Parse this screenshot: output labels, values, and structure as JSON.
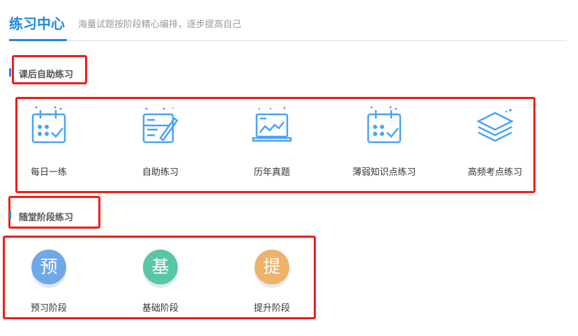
{
  "header": {
    "title": "练习中心",
    "subtitle": "海量试题按阶段精心编排，逐步提高自己"
  },
  "section1": {
    "title": "课后自助练习",
    "items": [
      {
        "label": "每日一练",
        "icon": "calendar-check-icon"
      },
      {
        "label": "自助练习",
        "icon": "notebook-pen-icon"
      },
      {
        "label": "历年真题",
        "icon": "laptop-chart-icon"
      },
      {
        "label": "薄弱知识点练习",
        "icon": "calendar-check-icon"
      },
      {
        "label": "高频考点练习",
        "icon": "layers-icon"
      }
    ]
  },
  "section2": {
    "title": "随堂阶段练习",
    "items": [
      {
        "label": "预习阶段",
        "glyph": "预",
        "color": "#6ea8e6"
      },
      {
        "label": "基础阶段",
        "glyph": "基",
        "color": "#57c7a8"
      },
      {
        "label": "提升阶段",
        "glyph": "提",
        "color": "#eeb26a"
      }
    ]
  },
  "colors": {
    "accent": "#1e88e5",
    "icon": "#4aa3f5",
    "annotation": "#f01d16"
  }
}
